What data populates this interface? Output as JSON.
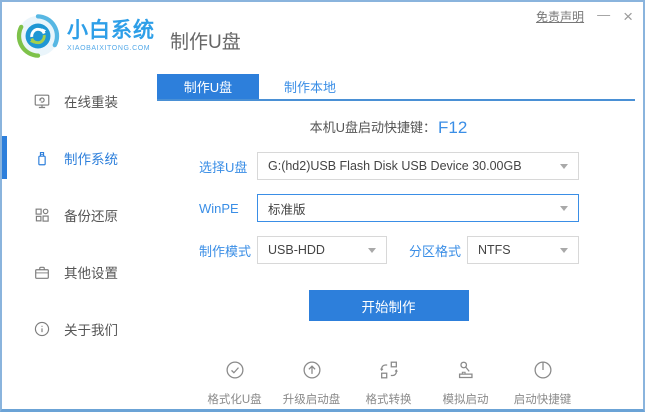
{
  "window": {
    "titlebar": {
      "disclaimer": "免责声明",
      "minimize": "—",
      "close": "×"
    },
    "logo": {
      "name": "小白系统",
      "domain": "XIAOBAIXITONG.COM"
    },
    "page_title": "制作U盘"
  },
  "sidebar": {
    "items": [
      {
        "label": "在线重装",
        "icon": "monitor-reinstall-icon",
        "active": false
      },
      {
        "label": "制作系统",
        "icon": "usb-drive-icon",
        "active": true
      },
      {
        "label": "备份还原",
        "icon": "backup-restore-icon",
        "active": false
      },
      {
        "label": "其他设置",
        "icon": "settings-case-icon",
        "active": false
      },
      {
        "label": "关于我们",
        "icon": "info-icon",
        "active": false
      }
    ]
  },
  "main": {
    "tabs": [
      {
        "label": "制作U盘",
        "active": true
      },
      {
        "label": "制作本地",
        "active": false
      }
    ],
    "hotkey": {
      "label": "本机U盘启动快捷键：",
      "value": "F12"
    },
    "form": {
      "usb_select": {
        "label": "选择U盘",
        "value": "G:(hd2)USB Flash Disk USB Device 30.00GB"
      },
      "winpe_select": {
        "label": "WinPE",
        "value": "标准版"
      },
      "mode_select": {
        "label": "制作模式",
        "value": "USB-HDD"
      },
      "partition_select": {
        "label": "分区格式",
        "value": "NTFS"
      }
    },
    "start_button": "开始制作",
    "tools": [
      {
        "label": "格式化U盘",
        "icon": "format-usb-icon"
      },
      {
        "label": "升级启动盘",
        "icon": "upgrade-boot-icon"
      },
      {
        "label": "格式转换",
        "icon": "format-convert-icon"
      },
      {
        "label": "模拟启动",
        "icon": "simulate-boot-icon"
      },
      {
        "label": "启动快捷键",
        "icon": "boot-hotkey-icon"
      }
    ]
  },
  "colors": {
    "accent_blue": "#2d7fdb",
    "link_blue": "#3a8ee6",
    "logo_blue": "#2e9fe8",
    "icon_gray": "#8a8a8a",
    "border_blue": "#8ab4dd"
  }
}
